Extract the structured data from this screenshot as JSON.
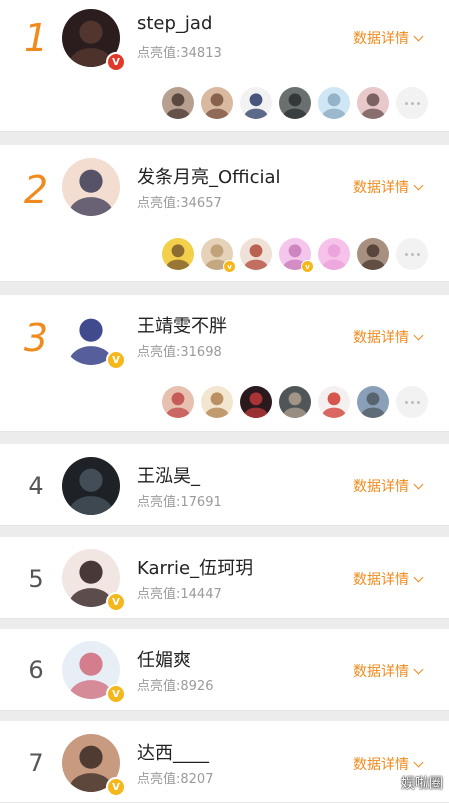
{
  "detail_label": "数据详情",
  "watermark": "娱啦圈",
  "entries": [
    {
      "rank": "1",
      "name": "step_jad",
      "score": "点亮值:34813",
      "badge": "red",
      "avatar_colors": [
        "#2b1c1e",
        "#5a3a32"
      ],
      "fans": [
        {
          "c1": "#b8a090",
          "c2": "#4a3a33",
          "v": false
        },
        {
          "c1": "#d9b9a0",
          "c2": "#7a5240",
          "v": false
        },
        {
          "c1": "#f2f2f2",
          "c2": "#2a3b66",
          "v": false
        },
        {
          "c1": "#6a7070",
          "c2": "#2a2e30",
          "v": false
        },
        {
          "c1": "#cfe6f4",
          "c2": "#8aa8c0",
          "v": false
        },
        {
          "c1": "#e8c8c8",
          "c2": "#6a5050",
          "v": false
        }
      ]
    },
    {
      "rank": "2",
      "name": "发条月亮_Official",
      "score": "点亮值:34657",
      "badge": "none",
      "avatar_colors": [
        "#f3dcd0",
        "#3a3a55"
      ],
      "fans": [
        {
          "c1": "#f2d04a",
          "c2": "#7a5a30",
          "v": false
        },
        {
          "c1": "#e6d2b8",
          "c2": "#b89a70",
          "v": true
        },
        {
          "c1": "#efe0d8",
          "c2": "#b04a3a",
          "v": false
        },
        {
          "c1": "#f4c6ec",
          "c2": "#c87ab8",
          "v": true
        },
        {
          "c1": "#f7c2ea",
          "c2": "#e9a0d8",
          "v": false
        },
        {
          "c1": "#a89080",
          "c2": "#4a3a30",
          "v": false
        }
      ]
    },
    {
      "rank": "3",
      "name": "王靖雯不胖",
      "score": "点亮值:31698",
      "badge": "gold",
      "avatar_colors": [
        "#ffffff",
        "#1e2a78"
      ],
      "fans": [
        {
          "c1": "#e8c0b0",
          "c2": "#c04a4a",
          "v": false
        },
        {
          "c1": "#f3e6d0",
          "c2": "#b08050",
          "v": false
        },
        {
          "c1": "#2a1a1e",
          "c2": "#c03a3a",
          "v": false
        },
        {
          "c1": "#505558",
          "c2": "#b0a090",
          "v": false
        },
        {
          "c1": "#f5f0f0",
          "c2": "#d03a30",
          "v": false
        },
        {
          "c1": "#8aa0b8",
          "c2": "#505a60",
          "v": false
        }
      ]
    },
    {
      "rank": "4",
      "name": "王泓昊_",
      "score": "点亮值:17691",
      "badge": "none",
      "avatar_colors": [
        "#1e2226",
        "#4a5560"
      ],
      "fans": []
    },
    {
      "rank": "5",
      "name": "Karrie_伍珂玥",
      "score": "点亮值:14447",
      "badge": "gold",
      "avatar_colors": [
        "#f2e6e2",
        "#2a1a1a"
      ],
      "fans": []
    },
    {
      "rank": "6",
      "name": "任媚爽",
      "score": "点亮值:8926",
      "badge": "gold",
      "avatar_colors": [
        "#e8eef6",
        "#d06a7a"
      ],
      "fans": []
    },
    {
      "rank": "7",
      "name": "达西____",
      "score": "点亮值:8207",
      "badge": "gold",
      "avatar_colors": [
        "#c89a80",
        "#3a2a24"
      ],
      "fans": []
    }
  ]
}
